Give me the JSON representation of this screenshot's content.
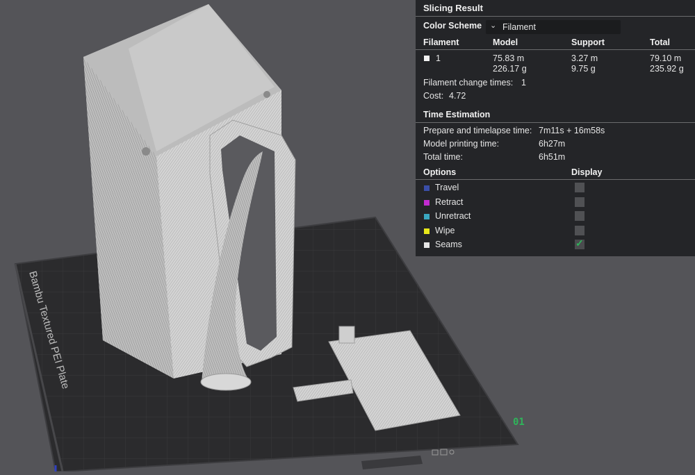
{
  "viewport": {
    "plate_name": "Bambu Textured PEI Plate",
    "plate_number": "01",
    "colors": {
      "background": "#545458",
      "plate": "#2b2b2d",
      "model": "#cfcfcf",
      "accent": "#2fb45a"
    }
  },
  "slicing_result": {
    "title": "Slicing Result",
    "color_scheme_label": "Color Scheme",
    "color_scheme_value": "Filament",
    "table": {
      "headers": [
        "Filament",
        "Model",
        "Support",
        "Total"
      ],
      "row": {
        "filament": "1",
        "model_length": "75.83 m",
        "model_weight": "226.17 g",
        "support_length": "3.27 m",
        "support_weight": "9.75 g",
        "total_length": "79.10 m",
        "total_weight": "235.92 g"
      }
    },
    "filament_change_label": "Filament change times:",
    "filament_change_value": "1",
    "cost_label": "Cost:",
    "cost_value": "4.72",
    "time_estimation": {
      "heading": "Time Estimation",
      "prepare_label": "Prepare and timelapse time:",
      "prepare_value": "7m11s + 16m58s",
      "model_label": "Model printing time:",
      "model_value": "6h27m",
      "total_label": "Total time:",
      "total_value": "6h51m"
    },
    "options": {
      "heading": "Options",
      "display_heading": "Display",
      "items": [
        {
          "label": "Travel",
          "color": "#3a4ea8",
          "checked": false
        },
        {
          "label": "Retract",
          "color": "#c22bd0",
          "checked": false
        },
        {
          "label": "Unretract",
          "color": "#3aa7c0",
          "checked": false
        },
        {
          "label": "Wipe",
          "color": "#e8e81a",
          "checked": false
        },
        {
          "label": "Seams",
          "color": "#e6e6e6",
          "checked": true
        }
      ]
    }
  }
}
